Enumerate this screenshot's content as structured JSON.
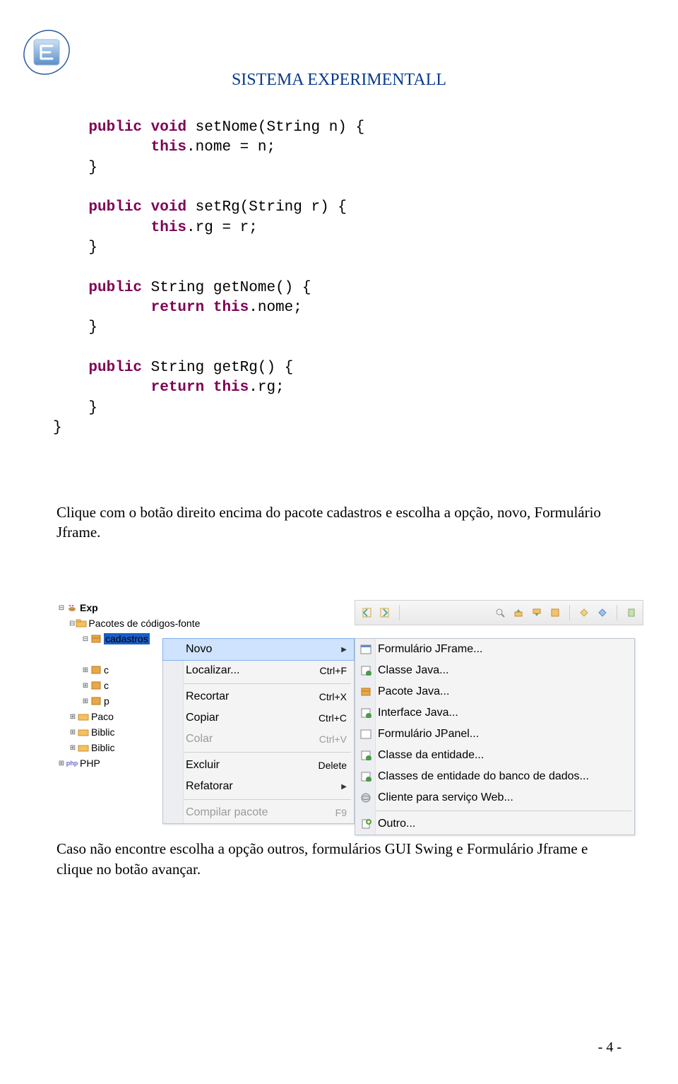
{
  "header": {
    "title": "SISTEMA EXPERIMENTALL"
  },
  "code": {
    "l1a": "public",
    "l1b": " void",
    "l1c": " setNome(String n) {",
    "l2a": "this",
    "l2b": ".nome = n;",
    "l3": "}",
    "l4a": "public",
    "l4b": " void",
    "l4c": " setRg(String r) {",
    "l5a": "this",
    "l5b": ".rg = r;",
    "l6": "}",
    "l7a": "public",
    "l7b": " String getNome() {",
    "l8a": "return this",
    "l8b": ".nome;",
    "l9": "}",
    "l10a": "public",
    "l10b": " String getRg() {",
    "l11a": "return this",
    "l11b": ".rg;",
    "l12": "}",
    "l13": "}"
  },
  "para1": "Clique com o botão direito encima do pacote cadastros e escolha a opção, novo, Formulário Jframe.",
  "para2": "Caso não encontre escolha a opção outros, formulários GUI Swing e Formulário Jframe e clique no botão avançar.",
  "tree": {
    "exp": "Exp",
    "pacotes": "Pacotes de códigos-fonte",
    "cadastros": "cadastros",
    "paco": "Paco",
    "biblic1": "Biblic",
    "biblic2": "Biblic",
    "php": "PHP"
  },
  "menu": {
    "novo": "Novo",
    "localizar": "Localizar...",
    "recortar": "Recortar",
    "copiar": "Copiar",
    "colar": "Colar",
    "excluir": "Excluir",
    "refatorar": "Refatorar",
    "compilar": "Compilar pacote",
    "sc_localizar": "Ctrl+F",
    "sc_recortar": "Ctrl+X",
    "sc_copiar": "Ctrl+C",
    "sc_colar": "Ctrl+V",
    "sc_excluir": "Delete",
    "sc_compilar": "F9"
  },
  "submenu": {
    "jframe": "Formulário JFrame...",
    "classe": "Classe Java...",
    "pacote": "Pacote Java...",
    "interface": "Interface Java...",
    "jpanel": "Formulário JPanel...",
    "entidade": "Classe da entidade...",
    "entidadedb": "Classes de entidade do banco de dados...",
    "cliente": "Cliente para serviço Web...",
    "outro": "Outro..."
  },
  "footer": {
    "page": "- 4 -"
  }
}
